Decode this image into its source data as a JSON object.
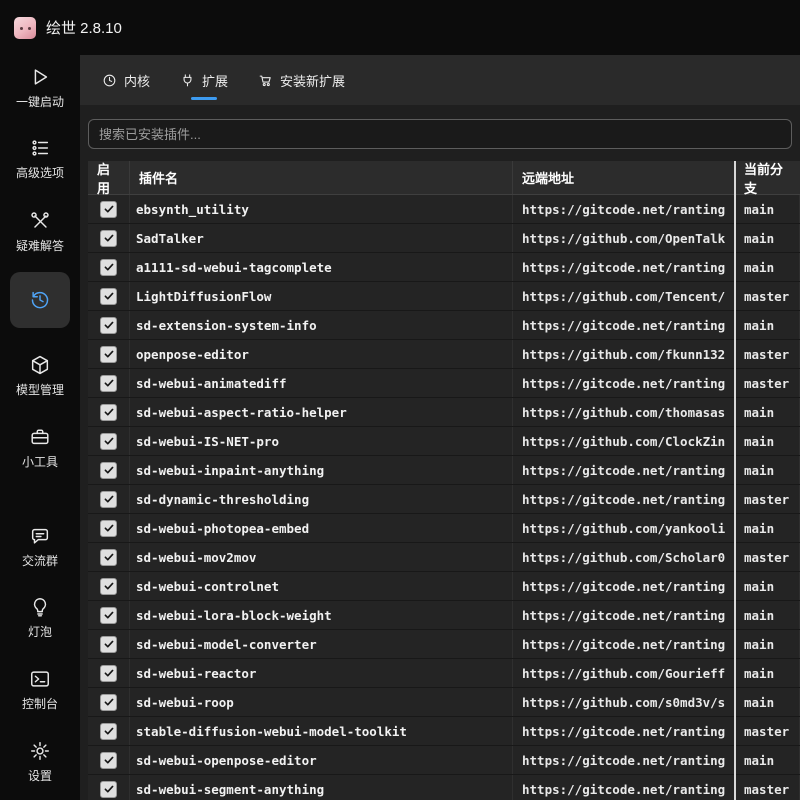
{
  "titlebar": {
    "title": "绘世 2.8.10"
  },
  "sidebar": {
    "items": [
      {
        "label": "一键启动",
        "icon": "play-icon",
        "selected": false
      },
      {
        "label": "高级选项",
        "icon": "sliders-icon",
        "selected": false
      },
      {
        "label": "疑难解答",
        "icon": "tools-icon",
        "selected": false
      },
      {
        "label": "",
        "icon": "version-history-icon",
        "selected": true
      },
      {
        "label": "模型管理",
        "icon": "model-cube-icon",
        "selected": false
      },
      {
        "label": "小工具",
        "icon": "toolbox-icon",
        "selected": false
      },
      {
        "label": "交流群",
        "icon": "chat-icon",
        "selected": false
      },
      {
        "label": "灯泡",
        "icon": "bulb-icon",
        "selected": false
      },
      {
        "label": "控制台",
        "icon": "console-icon",
        "selected": false
      },
      {
        "label": "设置",
        "icon": "gear-icon",
        "selected": false
      }
    ]
  },
  "tabs": [
    {
      "label": "内核",
      "icon": "kernel-clock-icon",
      "selected": false
    },
    {
      "label": "扩展",
      "icon": "plug-icon",
      "selected": true
    },
    {
      "label": "安装新扩展",
      "icon": "cart-icon",
      "selected": false
    }
  ],
  "search": {
    "placeholder": "搜索已安装插件..."
  },
  "table": {
    "columns": [
      "启用",
      "插件名",
      "远端地址",
      "当前分支"
    ],
    "rows": [
      {
        "enabled": true,
        "name": "ebsynth_utility",
        "remote": "https://gitcode.net/ranting",
        "branch": "main"
      },
      {
        "enabled": true,
        "name": "SadTalker",
        "remote": "https://github.com/OpenTalk",
        "branch": "main"
      },
      {
        "enabled": true,
        "name": "a1111-sd-webui-tagcomplete",
        "remote": "https://gitcode.net/ranting",
        "branch": "main"
      },
      {
        "enabled": true,
        "name": "LightDiffusionFlow",
        "remote": "https://github.com/Tencent/",
        "branch": "master"
      },
      {
        "enabled": true,
        "name": "sd-extension-system-info",
        "remote": "https://gitcode.net/ranting",
        "branch": "main"
      },
      {
        "enabled": true,
        "name": "openpose-editor",
        "remote": "https://github.com/fkunn132",
        "branch": "master"
      },
      {
        "enabled": true,
        "name": "sd-webui-animatediff",
        "remote": "https://gitcode.net/ranting",
        "branch": "master"
      },
      {
        "enabled": true,
        "name": "sd-webui-aspect-ratio-helper",
        "remote": "https://github.com/thomasas",
        "branch": "main"
      },
      {
        "enabled": true,
        "name": "sd-webui-IS-NET-pro",
        "remote": "https://github.com/ClockZin",
        "branch": "main"
      },
      {
        "enabled": true,
        "name": "sd-webui-inpaint-anything",
        "remote": "https://gitcode.net/ranting",
        "branch": "main"
      },
      {
        "enabled": true,
        "name": "sd-dynamic-thresholding",
        "remote": "https://gitcode.net/ranting",
        "branch": "master"
      },
      {
        "enabled": true,
        "name": "sd-webui-photopea-embed",
        "remote": "https://github.com/yankooli",
        "branch": "main"
      },
      {
        "enabled": true,
        "name": "sd-webui-mov2mov",
        "remote": "https://github.com/Scholar0",
        "branch": "master"
      },
      {
        "enabled": true,
        "name": "sd-webui-controlnet",
        "remote": "https://gitcode.net/ranting",
        "branch": "main"
      },
      {
        "enabled": true,
        "name": "sd-webui-lora-block-weight",
        "remote": "https://gitcode.net/ranting",
        "branch": "main"
      },
      {
        "enabled": true,
        "name": "sd-webui-model-converter",
        "remote": "https://gitcode.net/ranting",
        "branch": "main"
      },
      {
        "enabled": true,
        "name": "sd-webui-reactor",
        "remote": "https://github.com/Gourieff",
        "branch": "main"
      },
      {
        "enabled": true,
        "name": "sd-webui-roop",
        "remote": "https://github.com/s0md3v/s",
        "branch": "main"
      },
      {
        "enabled": true,
        "name": "stable-diffusion-webui-model-toolkit",
        "remote": "https://gitcode.net/ranting",
        "branch": "master"
      },
      {
        "enabled": true,
        "name": "sd-webui-openpose-editor",
        "remote": "https://gitcode.net/ranting",
        "branch": "main"
      },
      {
        "enabled": true,
        "name": "sd-webui-segment-anything",
        "remote": "https://gitcode.net/ranting",
        "branch": "master"
      }
    ]
  },
  "colors": {
    "accent": "#3d9bf0",
    "selected_icon": "#4fa3f5",
    "column_divider": "#d8d8d8"
  }
}
